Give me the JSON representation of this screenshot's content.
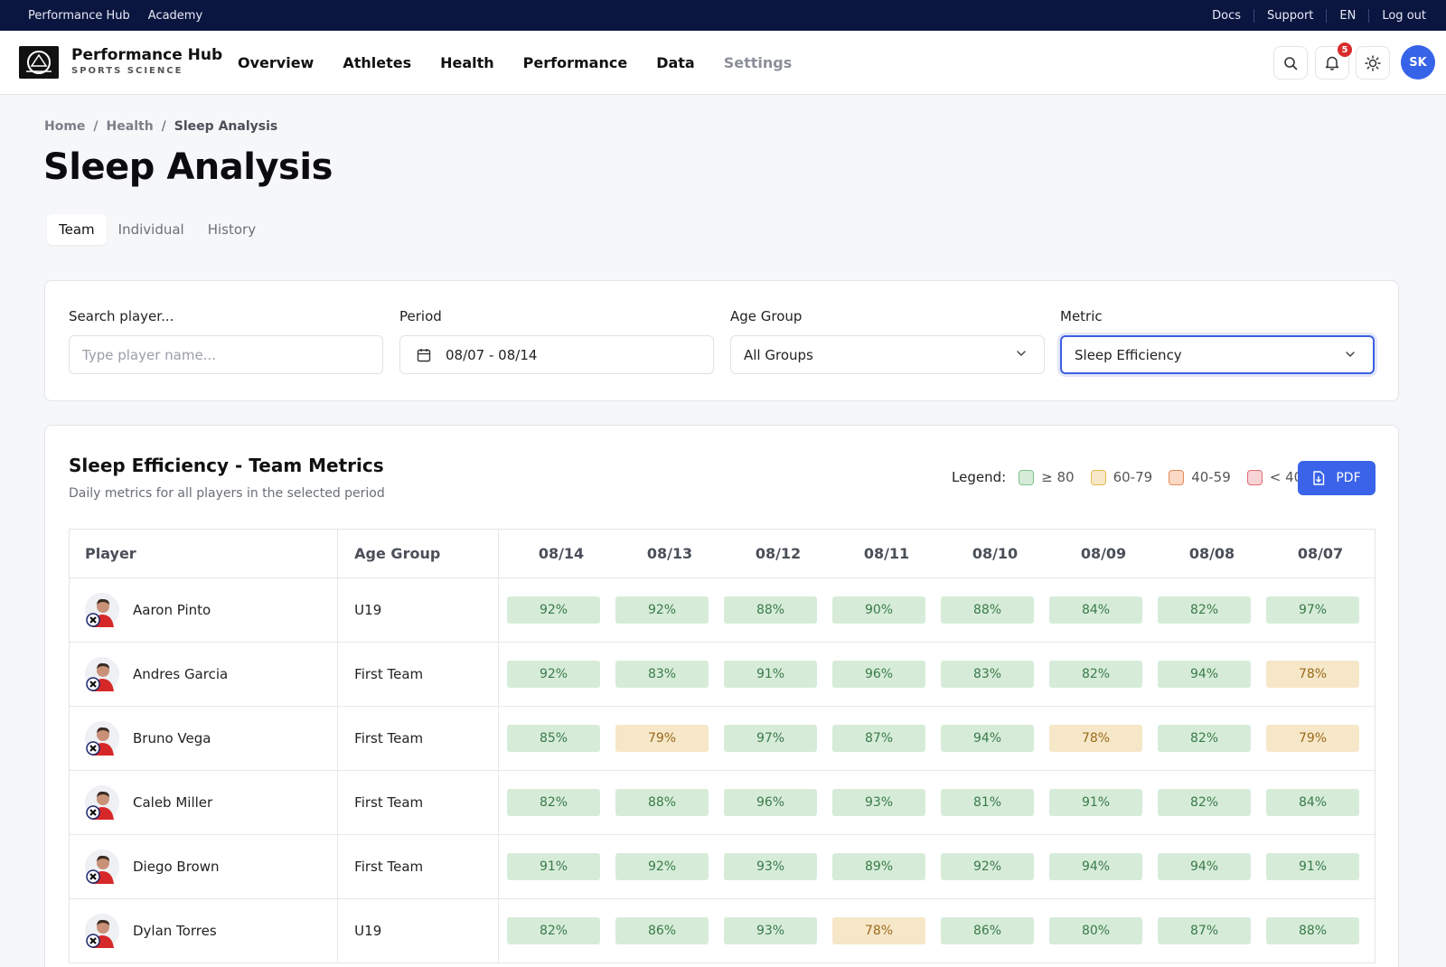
{
  "topbar": {
    "left": [
      "Performance Hub",
      "Academy"
    ],
    "right": [
      "Docs",
      "Support",
      "EN",
      "Log out"
    ]
  },
  "brand": {
    "title": "Performance Hub",
    "subtitle": "SPORTS SCIENCE"
  },
  "nav": [
    "Overview",
    "Athletes",
    "Health",
    "Performance",
    "Data",
    "Settings"
  ],
  "header": {
    "notification_count": "5",
    "user_initials": "SK"
  },
  "breadcrumb": {
    "home": "Home",
    "section": "Health",
    "current": "Sleep Analysis",
    "sep": "/"
  },
  "page_title": "Sleep Analysis",
  "tabs": [
    "Team",
    "Individual",
    "History"
  ],
  "filters": {
    "search": {
      "label": "Search player...",
      "placeholder": "Type player name..."
    },
    "period": {
      "label": "Period",
      "value": "08/07 - 08/14"
    },
    "age_group": {
      "label": "Age Group",
      "value": "All Groups"
    },
    "metric": {
      "label": "Metric",
      "value": "Sleep Efficiency"
    }
  },
  "table": {
    "title": "Sleep Efficiency - Team Metrics",
    "subtitle": "Daily metrics for all players in the selected period",
    "legend": {
      "label": "Legend:",
      "items": [
        {
          "label": "≥ 80",
          "color": "#d6ecd9",
          "border": "#7cc48b"
        },
        {
          "label": "60-79",
          "color": "#f6e7c8",
          "border": "#e6b94a"
        },
        {
          "label": "40-59",
          "color": "#fbd9c6",
          "border": "#e68a57"
        },
        {
          "label": "< 40",
          "color": "#f8d3d5",
          "border": "#e06b73"
        }
      ]
    },
    "pdf_label": "PDF",
    "headers": {
      "player": "Player",
      "age_group": "Age Group"
    },
    "dates": [
      "08/14",
      "08/13",
      "08/12",
      "08/11",
      "08/10",
      "08/09",
      "08/08",
      "08/07"
    ],
    "rows": [
      {
        "player": "Aaron Pinto",
        "age_group": "U19",
        "values": [
          92,
          92,
          88,
          90,
          88,
          84,
          82,
          97
        ]
      },
      {
        "player": "Andres Garcia",
        "age_group": "First Team",
        "values": [
          92,
          83,
          91,
          96,
          83,
          82,
          94,
          78
        ]
      },
      {
        "player": "Bruno Vega",
        "age_group": "First Team",
        "values": [
          85,
          79,
          97,
          87,
          94,
          78,
          82,
          79
        ]
      },
      {
        "player": "Caleb Miller",
        "age_group": "First Team",
        "values": [
          82,
          88,
          96,
          93,
          81,
          91,
          82,
          84
        ]
      },
      {
        "player": "Diego Brown",
        "age_group": "First Team",
        "values": [
          91,
          92,
          93,
          89,
          92,
          94,
          94,
          91
        ]
      },
      {
        "player": "Dylan Torres",
        "age_group": "U19",
        "values": [
          82,
          86,
          93,
          78,
          86,
          80,
          87,
          88
        ]
      }
    ]
  }
}
